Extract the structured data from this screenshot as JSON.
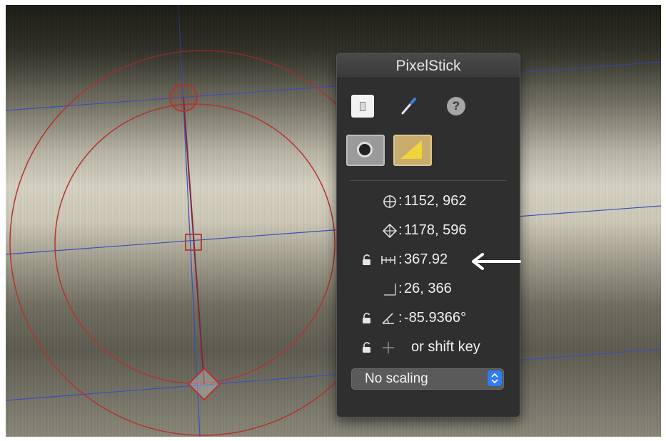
{
  "panel": {
    "title": "PixelStick",
    "readouts": [
      {
        "icon": "crosshair-circle-icon",
        "value": "1152, 962",
        "locked": null
      },
      {
        "icon": "crosshair-diamond-icon",
        "value": "1178, 596",
        "locked": null
      },
      {
        "icon": "distance-ruler-icon",
        "value": "367.92",
        "locked": false
      },
      {
        "icon": "delta-xy-icon",
        "value": "26, 366",
        "locked": null
      },
      {
        "icon": "angle-icon",
        "value": "-85.9366°",
        "locked": false
      },
      {
        "icon": "crosshair-plus-icon",
        "value": "or shift key",
        "locked": false
      }
    ],
    "scaling_select": {
      "value": "No scaling"
    }
  },
  "tools": {
    "toggle": "toggle-icon",
    "dropper": "eyedropper-icon",
    "help": "?",
    "camera_plain": "camera-icon",
    "camera_protractor": "camera-protractor-icon"
  },
  "colors": {
    "panel_bg": "#2f2f2f",
    "select_accent": "#2f7cf6",
    "guide_line": "#3b4fb8",
    "measure_circle": "#b0352f"
  }
}
